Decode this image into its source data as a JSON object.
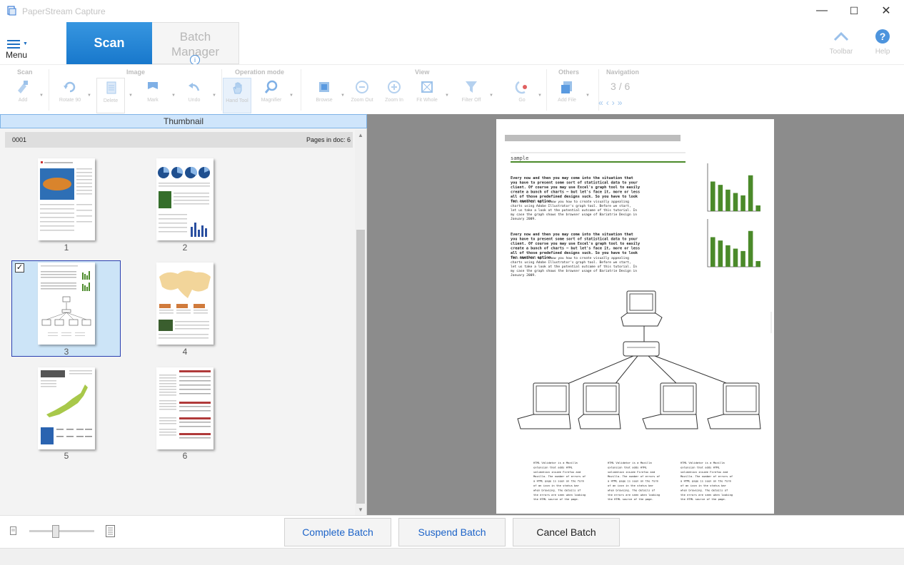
{
  "window": {
    "title": "PaperStream Capture",
    "controls": [
      "—",
      "☐",
      "✕"
    ]
  },
  "menu": {
    "label": "Menu"
  },
  "tabs": {
    "scan": "Scan",
    "batch_line1": "Batch",
    "batch_line2": "Manager",
    "batch_info": "i"
  },
  "top_right": [
    {
      "label": "Toolbar",
      "icon": "chevron-up-icon"
    },
    {
      "label": "Help",
      "icon": "help-icon"
    }
  ],
  "ribbon": {
    "groups": [
      "Scan",
      "Image",
      "Operation mode",
      "View",
      "Others",
      "Navigation"
    ],
    "tools": [
      {
        "label": "Add",
        "icon": "add-scan-icon"
      },
      {
        "label": "Rotate 90",
        "icon": "rotate-icon"
      },
      {
        "label": "Delete",
        "icon": "delete-icon"
      },
      {
        "label": "Mark",
        "icon": "mark-icon"
      },
      {
        "label": "Undo",
        "icon": "undo-icon"
      },
      {
        "label": "Hand Tool",
        "icon": "hand-tool-icon"
      },
      {
        "label": "Magnifier",
        "icon": "magnifier-icon"
      },
      {
        "label": "Browse",
        "icon": "browse-icon"
      },
      {
        "label": "Zoom Out",
        "icon": "zoom-out-icon"
      },
      {
        "label": "Zoom In",
        "icon": "zoom-in-icon"
      },
      {
        "label": "Fit Whole",
        "icon": "fit-whole-icon"
      },
      {
        "label": "Filter Off",
        "icon": "filter-icon"
      },
      {
        "label": "Go",
        "icon": "go-icon"
      },
      {
        "label": "Add File",
        "icon": "add-file-icon"
      }
    ],
    "navigation": {
      "current": "3",
      "separator": "/",
      "total": "6"
    }
  },
  "left_panel": {
    "header": "Thumbnail",
    "doc_id": "0001",
    "pages_in_doc": "Pages in doc: 6",
    "thumbnails": [
      {
        "num": "1"
      },
      {
        "num": "2"
      },
      {
        "num": "3",
        "checked": "✓"
      },
      {
        "num": "4"
      },
      {
        "num": "5"
      },
      {
        "num": "6"
      }
    ]
  },
  "preview": {
    "page_heading": "sample",
    "para_bold": "Every now and then you may come into the situation that you have to present some sort of statistical data to your client. Of course you may use Excel's graph tool to easily create a bunch of charts — but let's face it, more or less all of those predefined designs suck. So you have to look for another option.",
    "para_normal": "This tutorial will show you how to create visually appealing charts using Adobe Illustrator's graph tool. Before we start, let us take a look at the potential outcome of this tutorial. In my case the graph shows the browser usage of Bariatrie Design in January 2009.",
    "caption": "HTML Validator is a Mozilla extension that adds HTML validation inside Firefox and Mozilla. The number of errors of a HTML page is seen on the form of an icon in the status bar when browsing. The details of the errors are seen when looking the HTML source of the page.",
    "chart_bars": [
      0.62,
      0.55,
      0.45,
      0.38,
      0.33,
      0.75,
      0.12
    ]
  },
  "bottom": {
    "complete": "Complete Batch",
    "suspend": "Suspend Batch",
    "cancel": "Cancel Batch"
  },
  "colors": {
    "accent": "#1878cc",
    "selection": "#cce4f7",
    "selection_border": "#2a3fb0",
    "bar_green": "#4b8a2a"
  }
}
